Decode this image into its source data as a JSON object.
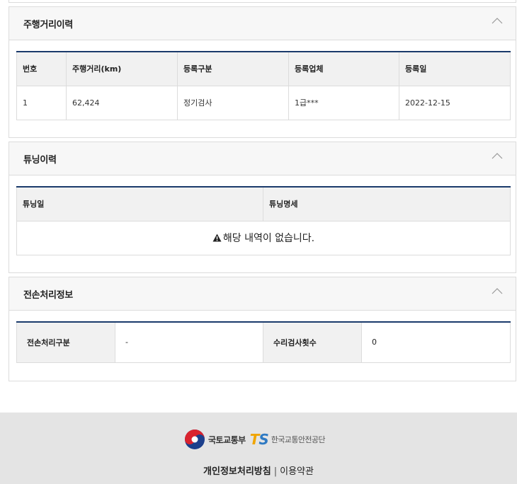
{
  "mileage": {
    "title": "주행거리이력",
    "headers": [
      "번호",
      "주행거리(km)",
      "등록구분",
      "등록업체",
      "등록일"
    ],
    "rows": [
      [
        "1",
        "62,424",
        "정기검사",
        "1급***",
        "2022-12-15"
      ]
    ]
  },
  "tuning": {
    "title": "튜닝이력",
    "headers": [
      "튜닝일",
      "튜닝명세"
    ],
    "empty_message": "해당 내역이 없습니다."
  },
  "total_loss": {
    "title": "전손처리정보",
    "label_type": "전손처리구분",
    "value_type": "-",
    "label_inspections": "수리검사횟수",
    "value_inspections": "0"
  },
  "footer": {
    "moltm_name": "국토교통부",
    "ts_mark_t": "T",
    "ts_mark_s": "S",
    "ts_name": "한국교통안전공단",
    "privacy_link": "개인정보처리방침",
    "separator": "|",
    "terms_link": "이용약관"
  },
  "colors": {
    "table_top_border": "#1a3a6b",
    "header_bg": "#f1f1f1",
    "footer_bg": "#e4e4e4",
    "ts_orange": "#f0a500",
    "ts_blue": "#2f7ac3"
  }
}
